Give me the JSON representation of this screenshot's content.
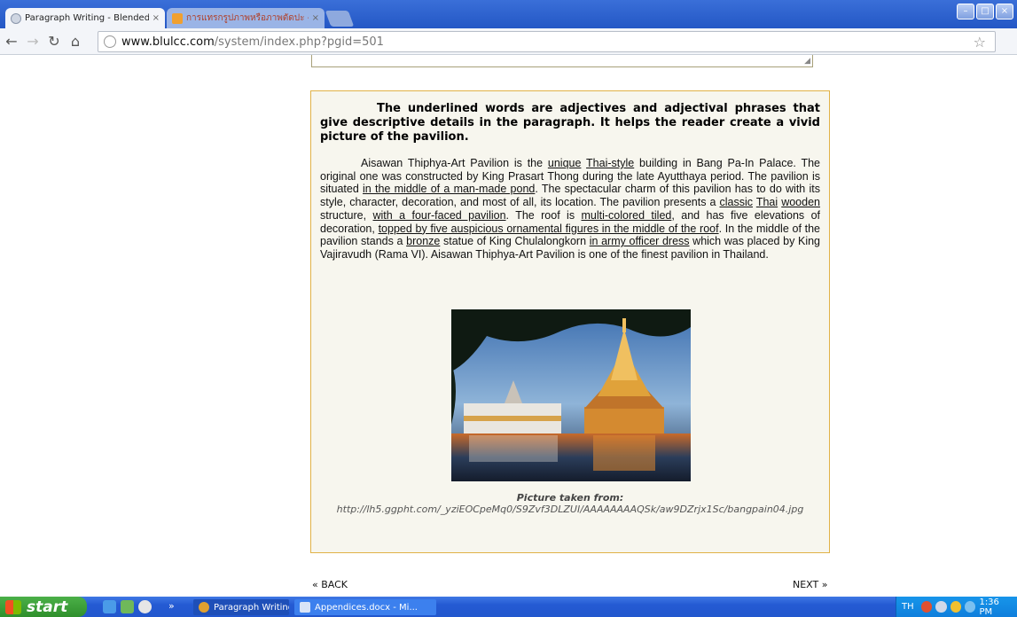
{
  "browser": {
    "tabs": [
      {
        "title": "Paragraph Writing - Blended Le",
        "active": true
      },
      {
        "title": "การแทรกรูปภาพหรือภาพตัดปะ -",
        "active": false
      }
    ],
    "url_host": "www.blulcc.com",
    "url_path": "/system/index.php?pgid=501",
    "icons": {
      "back": "back-arrow-icon",
      "forward": "forward-arrow-icon",
      "reload": "reload-icon",
      "home": "home-icon",
      "bookmark": "star-icon",
      "menu": "wrench-icon"
    }
  },
  "content": {
    "heading": "The underlined words are adjectives and adjectival phrases that give descriptive details in the paragraph. It helps the reader create a vivid picture of the pavilion.",
    "paragraph_segments": [
      {
        "t": "Aisawan Thiphya-Art Pavilion is the ",
        "u": false
      },
      {
        "t": "unique",
        "u": true
      },
      {
        "t": " ",
        "u": false
      },
      {
        "t": "Thai-style",
        "u": true
      },
      {
        "t": " building in Bang Pa-In Palace. The original one was constructed by King Prasart Thong during the late Ayutthaya period. The pavilion is situated ",
        "u": false
      },
      {
        "t": "in the middle of a man-made pond",
        "u": true
      },
      {
        "t": ". The spectacular charm of this pavilion has to do with its style, character, decoration, and most of all, its location. The pavilion presents a ",
        "u": false
      },
      {
        "t": "classic",
        "u": true
      },
      {
        "t": " ",
        "u": false
      },
      {
        "t": "Thai",
        "u": true
      },
      {
        "t": " ",
        "u": false
      },
      {
        "t": "wooden",
        "u": true
      },
      {
        "t": " structure, ",
        "u": false
      },
      {
        "t": "with a four-faced pavilion",
        "u": true
      },
      {
        "t": ". The roof is ",
        "u": false
      },
      {
        "t": "multi-colored tiled",
        "u": true
      },
      {
        "t": ", and has five elevations of decoration, ",
        "u": false
      },
      {
        "t": "topped by five auspicious ornamental figures in the middle of the roof",
        "u": true
      },
      {
        "t": ". In the middle of the pavilion stands a ",
        "u": false
      },
      {
        "t": "bronze",
        "u": true
      },
      {
        "t": " statue of King Chulalongkorn ",
        "u": false
      },
      {
        "t": "in army officer dress",
        "u": true
      },
      {
        "t": " which was placed by King Vajiravudh (Rama VI). Aisawan Thiphya-Art Pavilion is one of the finest pavilion in Thailand.",
        "u": false
      }
    ],
    "caption_title": "Picture taken from:",
    "caption_url": "http://lh5.ggpht.com/_yziEOCpeMq0/S9Zvf3DLZUI/AAAAAAAAQSk/aw9DZrjx1Sc/bangpain04.jpg"
  },
  "nav": {
    "back": "« BACK",
    "next": "NEXT »"
  },
  "taskbar": {
    "start": "start",
    "tasks": [
      "Paragraph Writing - B...",
      "Appendices.docx - Mi..."
    ],
    "lang": "TH",
    "clock": "1:36 PM"
  },
  "colors": {
    "box_border": "#e1b247",
    "box_bg": "#f7f6ee",
    "xp_blue": "#245ad3",
    "start_green": "#3a9d37"
  }
}
